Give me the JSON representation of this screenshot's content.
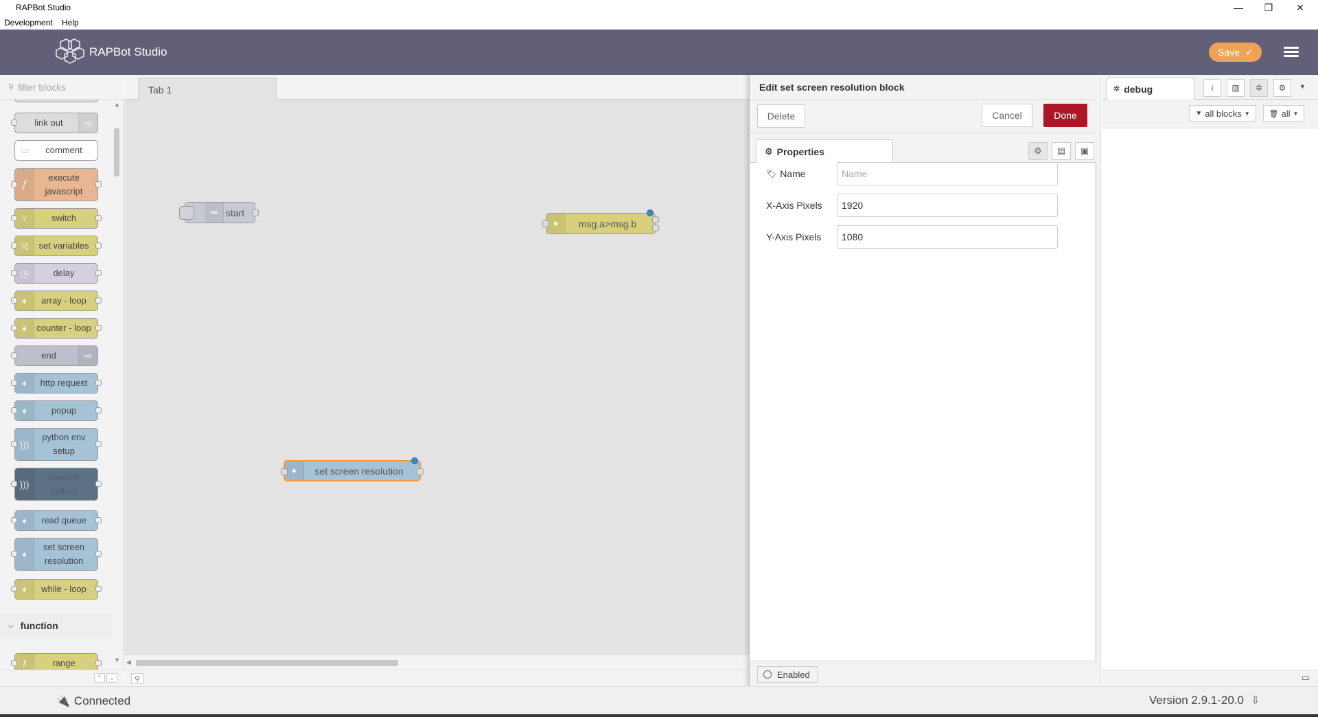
{
  "window": {
    "title": "RAPBot Studio",
    "controls": [
      "—",
      "❐",
      "✕"
    ]
  },
  "menu": [
    "Development",
    "Help"
  ],
  "header": {
    "app_name": "RAPBot Studio",
    "save_label": "Save"
  },
  "palette": {
    "filter_placeholder": "filter blocks",
    "nodes": [
      {
        "label": "link out",
        "color": "#dddddd"
      },
      {
        "label": "comment",
        "color": "#ffffff"
      },
      {
        "label": "execute javascript",
        "color": "#e8b690"
      },
      {
        "label": "switch",
        "color": "#d7d07e"
      },
      {
        "label": "set variables",
        "color": "#d7d07e"
      },
      {
        "label": "delay",
        "color": "#d5d0e0"
      },
      {
        "label": "array - loop",
        "color": "#d7d07e"
      },
      {
        "label": "counter - loop",
        "color": "#d7d07e"
      },
      {
        "label": "end",
        "color": "#bdc0cc"
      },
      {
        "label": "http request",
        "color": "#a5c2d6"
      },
      {
        "label": "popup",
        "color": "#a5c2d6"
      },
      {
        "label": "python env setup",
        "color": "#a5c2d6"
      },
      {
        "label": "execute python",
        "color": "#5d7184"
      },
      {
        "label": "read queue",
        "color": "#a5c2d6"
      },
      {
        "label": "set screen resolution",
        "color": "#a5c2d6"
      },
      {
        "label": "while - loop",
        "color": "#d7d07e"
      }
    ],
    "category": "function",
    "category_nodes": [
      {
        "label": "range",
        "color": "#d7d07e"
      }
    ]
  },
  "workspace": {
    "tab": "Tab 1",
    "nodes": [
      {
        "label": "start",
        "color": "#c6cad4"
      },
      {
        "label": "msg.a>msg.b",
        "color": "#d7d07e"
      },
      {
        "label": "set screen resolution",
        "color": "#a5c2d6"
      }
    ]
  },
  "editor": {
    "title": "Edit set screen resolution block",
    "delete_label": "Delete",
    "cancel_label": "Cancel",
    "done_label": "Done",
    "properties_tab": "Properties",
    "fields": {
      "name": {
        "label": "Name",
        "value": "",
        "placeholder": "Name"
      },
      "x": {
        "label": "X-Axis Pixels",
        "value": "1920"
      },
      "y": {
        "label": "Y-Axis Pixels",
        "value": "1080"
      }
    },
    "enabled_label": "Enabled"
  },
  "sidebar": {
    "tab": "debug",
    "filter_label": "all blocks",
    "clear_label": "all"
  },
  "status": {
    "connection": "Connected",
    "version": "Version 2.9.1-20.0"
  },
  "colors": {
    "header": "#626079",
    "save": "#f0a356",
    "done": "#ad1625",
    "selected_node_border": "#f39a3a"
  }
}
